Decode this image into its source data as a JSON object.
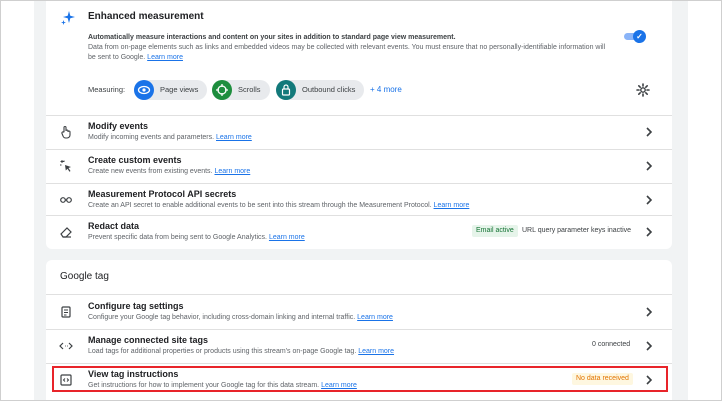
{
  "enhanced_measurement": {
    "title": "Enhanced measurement",
    "bold_text": "Automatically measure interactions and content on your sites in addition to standard page view measurement.",
    "desc": "Data from on-page elements such as links and embedded videos may be collected with relevant events. You must ensure that no personally-identifiable information will be sent to Google.",
    "learn_more": "Learn more",
    "toggle_icon": "checkmark-icon",
    "measuring_label": "Measuring:",
    "pills": [
      {
        "label": "Page views",
        "icon": "eye-icon",
        "color": "#1a73e8"
      },
      {
        "label": "Scrolls",
        "icon": "crosshair-icon",
        "color": "#1e8e3e"
      },
      {
        "label": "Outbound clicks",
        "icon": "lock-icon",
        "color": "#12797a"
      }
    ],
    "more_link": "+ 4 more"
  },
  "event_rows": [
    {
      "title": "Modify events",
      "desc": "Modify incoming events and parameters.",
      "learn_more": "Learn more",
      "icon": "touch-icon"
    },
    {
      "title": "Create custom events",
      "desc": "Create new events from existing events.",
      "learn_more": "Learn more",
      "icon": "sparkle-click-icon"
    },
    {
      "title": "Measurement Protocol API secrets",
      "desc": "Create an API secret to enable additional events to be sent into this stream through the Measurement Protocol.",
      "learn_more": "Learn more",
      "icon": "key-icon"
    },
    {
      "title": "Redact data",
      "desc": "Prevent specific data from being sent to Google Analytics.",
      "learn_more": "Learn more",
      "icon": "eraser-icon",
      "chip_green": "Email active",
      "chip_plain": "URL query parameter keys inactive"
    }
  ],
  "google_tag": {
    "heading": "Google tag",
    "rows": [
      {
        "title": "Configure tag settings",
        "desc": "Configure your Google tag behavior, including cross-domain linking and internal traffic.",
        "learn_more": "Learn more",
        "icon": "tag-icon"
      },
      {
        "title": "Manage connected site tags",
        "desc": "Load tags for additional properties or products using this stream's on-page Google tag.",
        "learn_more": "Learn more",
        "icon": "code-arrows-icon",
        "status": "0 connected"
      },
      {
        "title": "View tag instructions",
        "desc": "Get instructions for how to implement your Google tag for this data stream.",
        "learn_more": "Learn more",
        "icon": "code-box-icon",
        "status": "No data received"
      }
    ]
  },
  "colors": {
    "accent": "#1a73e8",
    "highlight": "#e8242a",
    "warning": "#e37400",
    "success": "#137333"
  }
}
